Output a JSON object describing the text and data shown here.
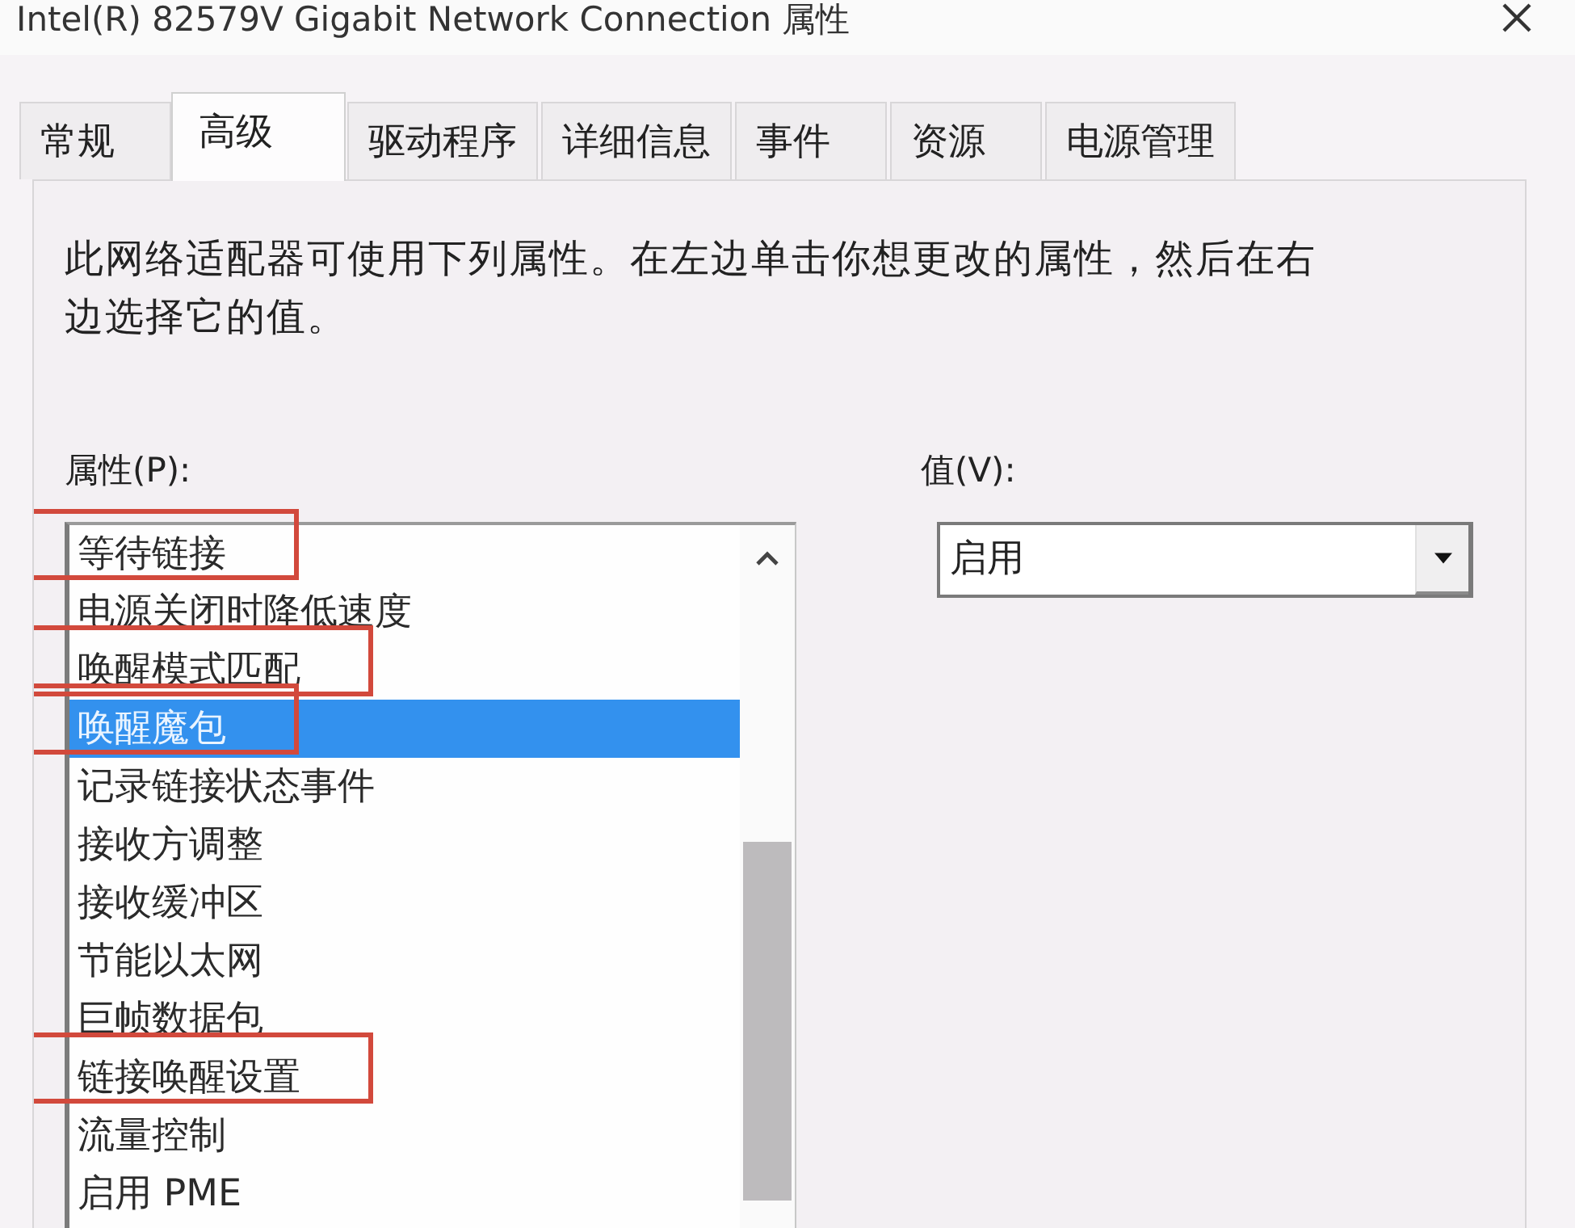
{
  "window": {
    "title": "Intel(R) 82579V Gigabit Network Connection 属性"
  },
  "tabs": [
    {
      "label": "常规",
      "selected": false
    },
    {
      "label": "高级",
      "selected": true
    },
    {
      "label": "驱动程序",
      "selected": false
    },
    {
      "label": "详细信息",
      "selected": false
    },
    {
      "label": "事件",
      "selected": false
    },
    {
      "label": "资源",
      "selected": false
    },
    {
      "label": "电源管理",
      "selected": false
    }
  ],
  "description": "此网络适配器可使用下列属性。在左边单击你想更改的属性，然后在右边选择它的值。",
  "property_list": {
    "label": "属性(P):",
    "items": [
      {
        "label": "等待链接",
        "selected": false,
        "marked": true
      },
      {
        "label": "电源关闭时降低速度",
        "selected": false,
        "marked": false
      },
      {
        "label": "唤醒模式匹配",
        "selected": false,
        "marked": true
      },
      {
        "label": "唤醒魔包",
        "selected": true,
        "marked": true
      },
      {
        "label": "记录链接状态事件",
        "selected": false,
        "marked": false
      },
      {
        "label": "接收方调整",
        "selected": false,
        "marked": false
      },
      {
        "label": "接收缓冲区",
        "selected": false,
        "marked": false
      },
      {
        "label": "节能以太网",
        "selected": false,
        "marked": false
      },
      {
        "label": "巨帧数据包",
        "selected": false,
        "marked": false
      },
      {
        "label": "链接唤醒设置",
        "selected": false,
        "marked": true
      },
      {
        "label": "流量控制",
        "selected": false,
        "marked": false
      },
      {
        "label": "启用 PME",
        "selected": false,
        "marked": false
      }
    ]
  },
  "value_field": {
    "label": "值(V):",
    "value": "启用"
  }
}
